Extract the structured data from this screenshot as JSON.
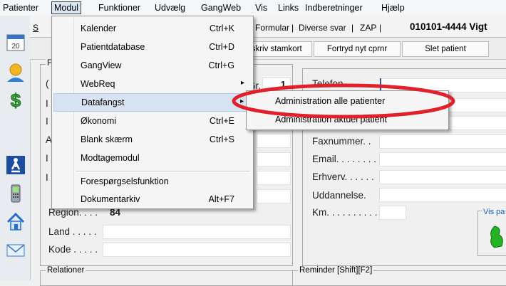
{
  "menubar": {
    "items": [
      "Patienter",
      "Modul",
      "Funktioner",
      "Udvælg",
      "GangWeb",
      "Vis",
      "Links",
      "Indberetninger",
      "Hjælp"
    ]
  },
  "tabs": {
    "partial_first": "S",
    "formular": "Formular",
    "diverse": "Diverse svar",
    "zap": "ZAP",
    "separator": "|",
    "cpr": "010101-4444 Vigt"
  },
  "toolbar": {
    "stamkort": "dskriv stamkort",
    "fortryd": "Fortryd nyt cprnr",
    "slet": "Slet patient"
  },
  "modul_menu": {
    "items": [
      {
        "label": "Kalender",
        "shortcut": "Ctrl+K"
      },
      {
        "label": "Patientdatabase",
        "shortcut": "Ctrl+D"
      },
      {
        "label": "GangView",
        "shortcut": "Ctrl+G"
      },
      {
        "label": "WebReq",
        "shortcut": "▸"
      },
      {
        "label": "Datafangst",
        "shortcut": "▸"
      },
      {
        "label": "Økonomi",
        "shortcut": "Ctrl+E"
      },
      {
        "label": "Blank skærm",
        "shortcut": "Ctrl+S"
      },
      {
        "label": "Modtagemodul",
        "shortcut": ""
      },
      {
        "label": "Forespørgselsfunktion",
        "shortcut": ""
      },
      {
        "label": "Dokumentarkiv",
        "shortcut": "Alt+F7"
      }
    ]
  },
  "submenu": {
    "items": [
      "Administration alle patienter",
      "Administration aktuel patient"
    ]
  },
  "left_form": {
    "group_title": "F",
    "partial_labels": [
      "(",
      "I",
      "I",
      "A",
      "I",
      "I"
    ],
    "region_label": "Region. . . .",
    "region_value": "84",
    "land_label": "Land . . . . .",
    "kode_label": "Kode . . . . .",
    "gr_label": "Gr.",
    "gr_value": "1"
  },
  "right_form": {
    "telefon": "Telefon. . . . .",
    "faxnummer": "Faxnummer. .",
    "email": "Email. . . . . . . .",
    "erhverv": "Erhverv. . . . . .",
    "uddannelse": "Uddannelse.",
    "km": "Km. . . . . . . . . .",
    "vis": "Vis pa"
  },
  "bottom": {
    "relationer": "Relationer",
    "reminder": "Reminder [Shift][F2]"
  },
  "colors": {
    "highlight_ring": "#e0202a",
    "menu_highlight": "#d7e3f2",
    "accent_blue": "#1a5fb4"
  },
  "icons": [
    "calendar-icon",
    "person-icon",
    "dollar-icon",
    "pedestrian-icon",
    "phone-icon",
    "home-icon",
    "mail-icon"
  ]
}
